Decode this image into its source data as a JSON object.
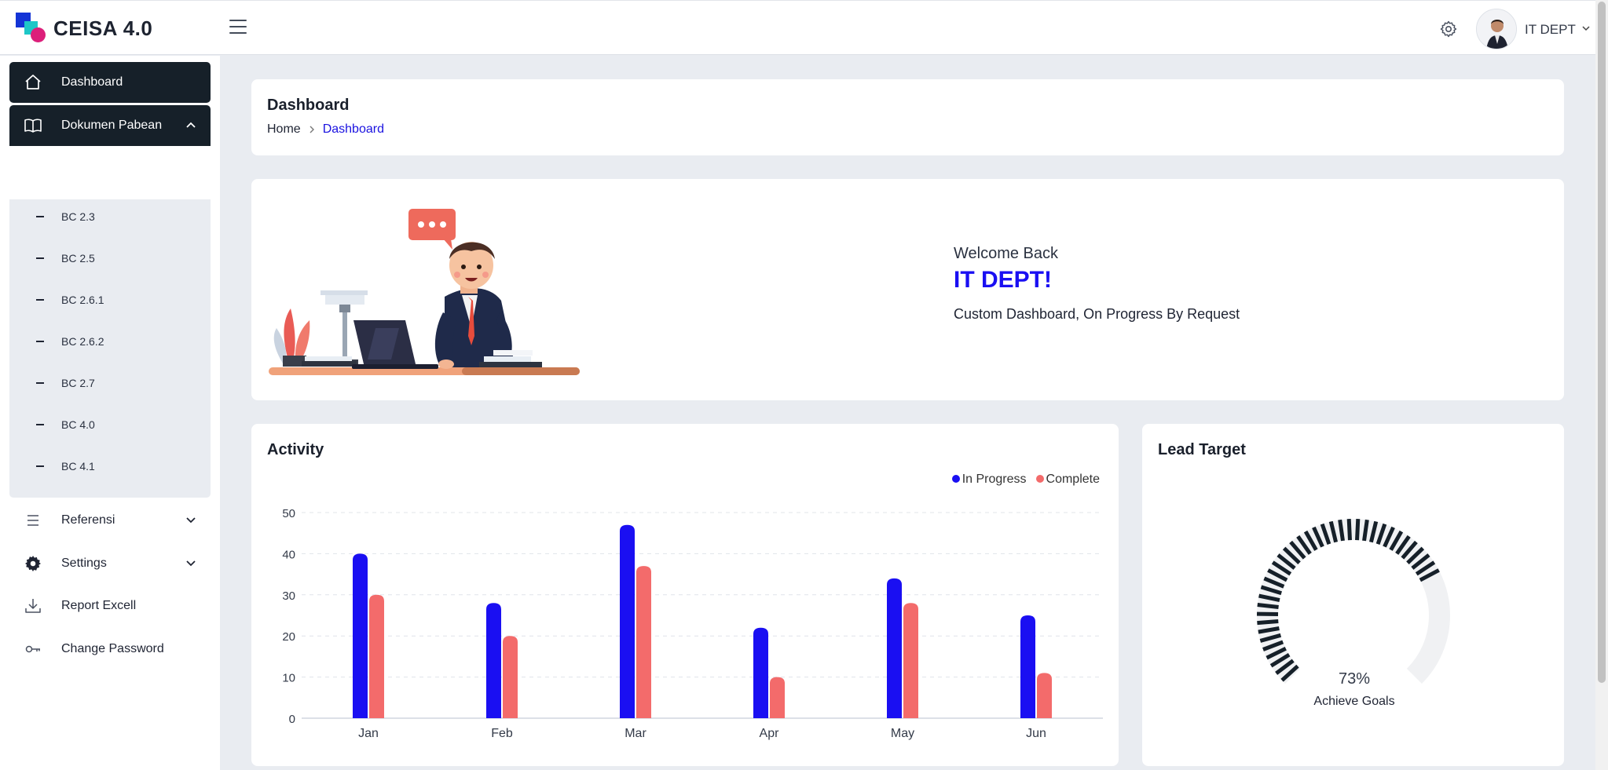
{
  "app": {
    "brand": "CEISA 4.0"
  },
  "header": {
    "user_name": "IT DEPT"
  },
  "sidebar": {
    "dashboard": "Dashboard",
    "dokumen": "Dokumen Pabean",
    "sub_items": [
      "BC 2.3",
      "BC 2.5",
      "BC 2.6.1",
      "BC 2.6.2",
      "BC 2.7",
      "BC 4.0",
      "BC 4.1"
    ],
    "referensi": "Referensi",
    "settings": "Settings",
    "report": "Report Excell",
    "change_password": "Change Password"
  },
  "page": {
    "title": "Dashboard",
    "breadcrumb_home": "Home",
    "breadcrumb_current": "Dashboard"
  },
  "welcome": {
    "greeting": "Welcome Back",
    "name": "IT DEPT!",
    "description": "Custom Dashboard, On Progress By Request"
  },
  "activity": {
    "title": "Activity",
    "legend_in_progress": "In Progress",
    "legend_complete": "Complete"
  },
  "lead_target": {
    "title": "Lead Target",
    "value": "73%",
    "label": "Achieve Goals",
    "fraction": 0.73
  },
  "colors": {
    "accent": "#1a0ff2",
    "in_progress": "#1a0ff2",
    "complete": "#f36b6b",
    "sidebar_active": "#162029"
  },
  "chart_data": {
    "type": "bar",
    "categories": [
      "Jan",
      "Feb",
      "Mar",
      "Apr",
      "May",
      "Jun"
    ],
    "series": [
      {
        "name": "In Progress",
        "values": [
          40,
          28,
          47,
          22,
          34,
          25
        ]
      },
      {
        "name": "Complete",
        "values": [
          30,
          20,
          37,
          10,
          28,
          11
        ]
      }
    ],
    "yticks": [
      0,
      10,
      20,
      30,
      40,
      50
    ],
    "ylim": [
      0,
      50
    ],
    "grid": true,
    "legend": "top-right"
  }
}
